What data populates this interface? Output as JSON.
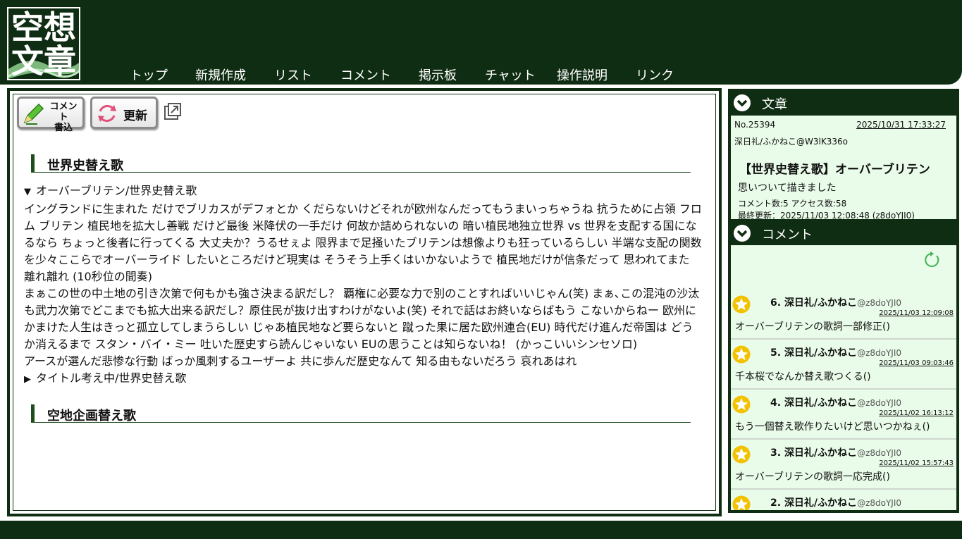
{
  "logo": {
    "chars": [
      "空",
      "想",
      "文",
      "章"
    ]
  },
  "nav": [
    {
      "label": "トップ"
    },
    {
      "label": "新規作成"
    },
    {
      "label": "リスト"
    },
    {
      "label": "コメント"
    },
    {
      "label": "掲示板"
    },
    {
      "label": "チャット"
    },
    {
      "label": "操作説明"
    },
    {
      "label": "リンク"
    }
  ],
  "toolbar": {
    "comment_button_line1": "コメント",
    "comment_button_line2": "書込",
    "refresh_label": "更新"
  },
  "sections": [
    {
      "title": "世界史替え歌"
    },
    {
      "title": "空地企画替え歌"
    }
  ],
  "songs": [
    {
      "marker": "▼",
      "title": "オーバーブリテン/世界史替え歌",
      "expanded": true,
      "lines": [
        "イングランドに生まれた だけでブリカスがデフォとか くだらないけどそれが欧州なんだってもうまいっちゃうね 抗うために占領 フロム ブリテン 植民地を拡大し善戦 だけど最後 米降伏の一手だけ 何故か詰められないの 暗い植民地独立世界 vs 世界を支配する国になるなら ちょっと後者に行ってくる 大丈夫か？うるせぇよ 限界まで足掻いたブリテンは想像よりも狂っているらしい 半端な支配の関数を少々ここらでオーバーライド したいところだけど現実は そうそう上手くはいかないようで 植民地だけが信条だって 思われてまた 離れ離れ (10秒位の間奏)",
        "まぁこの世の中土地の引き次第で何もかも強さ決まる訳だし？ 覇権に必要な力で別のことすればいいじゃん(笑) まぁ､この混沌の沙汰も武力次第でどこまでも拡大出来る訳だし？原住民が抜け出すわけがないよ(笑) それで話はお終いならばもう こないからねー 欧州にかまけた人生はきっと孤立してしまうらしい じゃあ植民地など要らないと 蹴った果に居た欧州連合(EU) 時代だけ進んだ帝国は どうか消えるまで スタン・バイ・ミー 吐いた歴史すら読んじゃいない EUの思うことは知らないね！ (かっこいいシンセソロ)",
        "アースが選んだ悲惨な行動 ばっか風刺するユーザーよ 共に歩んだ歴史なんて 知る由もないだろう 哀れあはれ"
      ]
    },
    {
      "marker": "▶",
      "title": "タイトル考え中/世界史替え歌",
      "expanded": false,
      "lines": []
    }
  ],
  "doc_panel": {
    "header": "文章",
    "number": "No.25394",
    "date": "2025/10/31 17:33:27",
    "author": "深日礼/ふかねこ@W3lK336o",
    "title": "【世界史替え歌】オーバーブリテン",
    "description": "思いついて描きました",
    "stats": "コメント数:5 アクセス数:58",
    "updated": "最終更新：2025/11/03 12:08:48 (z8doYJI0)"
  },
  "comment_panel": {
    "header": "コメント",
    "comments": [
      {
        "num": "6.",
        "name": "深日礼/ふかねこ",
        "uid": "@z8doYJI0",
        "date": "2025/11/03 12:09:08",
        "text": "オーバーブリテンの歌詞一部修正()"
      },
      {
        "num": "5.",
        "name": "深日礼/ふかねこ",
        "uid": "@z8doYJI0",
        "date": "2025/11/03 09:03:46",
        "text": "千本桜でなんか替え歌つくる()"
      },
      {
        "num": "4.",
        "name": "深日礼/ふかねこ",
        "uid": "@z8doYJI0",
        "date": "2025/11/02 16:13:12",
        "text": "もう一個替え歌作りたいけど思いつかねぇ()"
      },
      {
        "num": "3.",
        "name": "深日礼/ふかねこ",
        "uid": "@z8doYJI0",
        "date": "2025/11/02 15:57:43",
        "text": "オーバーブリテンの歌詞一応完成()"
      },
      {
        "num": "2.",
        "name": "深日礼/ふかねこ",
        "uid": "@z8doYJI0",
        "date": "",
        "text": ""
      }
    ]
  },
  "colors": {
    "dark_green": "#0f2d12",
    "panel_bg": "#e9fbe9",
    "star": "#f2c200"
  }
}
